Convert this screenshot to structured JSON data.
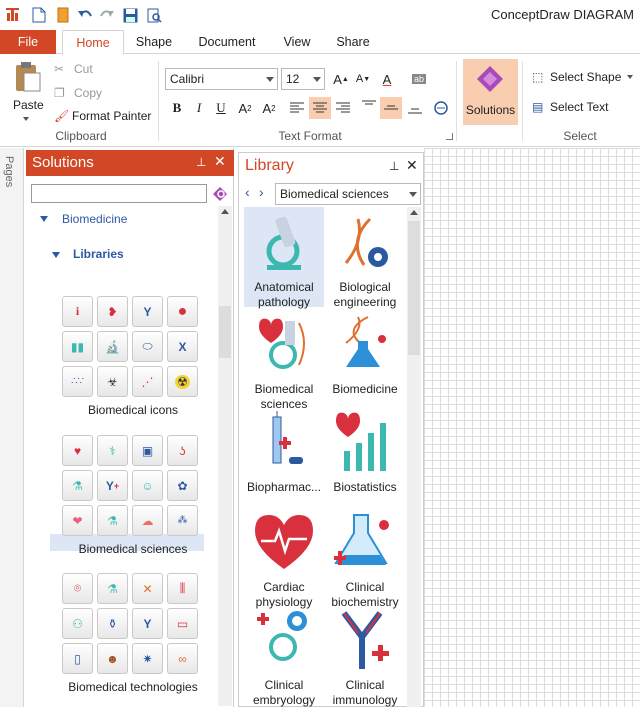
{
  "app": {
    "title": "ConceptDraw DIAGRAM"
  },
  "tabs": [
    "File",
    "Home",
    "Shape",
    "Document",
    "View",
    "Share"
  ],
  "ribbon": {
    "clipboard": {
      "paste": "Paste",
      "cut": "Cut",
      "copy": "Copy",
      "format_painter": "Format Painter",
      "label": "Clipboard"
    },
    "text_format": {
      "font": "Calibri",
      "size": "12",
      "label": "Text Format"
    },
    "solutions": {
      "label": "Solutions"
    },
    "select": {
      "select_shape": "Select Shape",
      "select_text": "Select Text",
      "label": "Select"
    }
  },
  "pages": {
    "label": "Pages"
  },
  "solutions_panel": {
    "title": "Solutions",
    "search_value": "",
    "tree": {
      "biomedicine": "Biomedicine",
      "libraries": "Libraries"
    },
    "libraries": [
      "Biomedical icons",
      "Biomedical sciences",
      "Biomedical technologies"
    ],
    "selected": "Biomedical sciences"
  },
  "library_panel": {
    "title": "Library",
    "selected_library": "Biomedical sciences",
    "items": [
      {
        "label": "Anatomical pathology",
        "icon": "microscope-icon"
      },
      {
        "label": "Biological engineering",
        "icon": "dna-gear-icon"
      },
      {
        "label": "Biomedical sciences",
        "icon": "heart-microscope-icon"
      },
      {
        "label": "Biomedicine",
        "icon": "flask-dna-icon"
      },
      {
        "label": "Biopharmac...",
        "icon": "syringe-pill-icon"
      },
      {
        "label": "Biostatistics",
        "icon": "heart-chart-icon"
      },
      {
        "label": "Cardiac physiology",
        "icon": "heart-pulse-icon"
      },
      {
        "label": "Clinical biochemistry",
        "icon": "flask-drop-icon"
      },
      {
        "label": "Clinical embryology",
        "icon": "embryo-icon"
      },
      {
        "label": "Clinical immunology",
        "icon": "antibody-icon"
      }
    ]
  },
  "colors": {
    "accent": "#d24726",
    "teal": "#3bb8b0",
    "red": "#d9303e",
    "blue": "#2c5aa0"
  }
}
